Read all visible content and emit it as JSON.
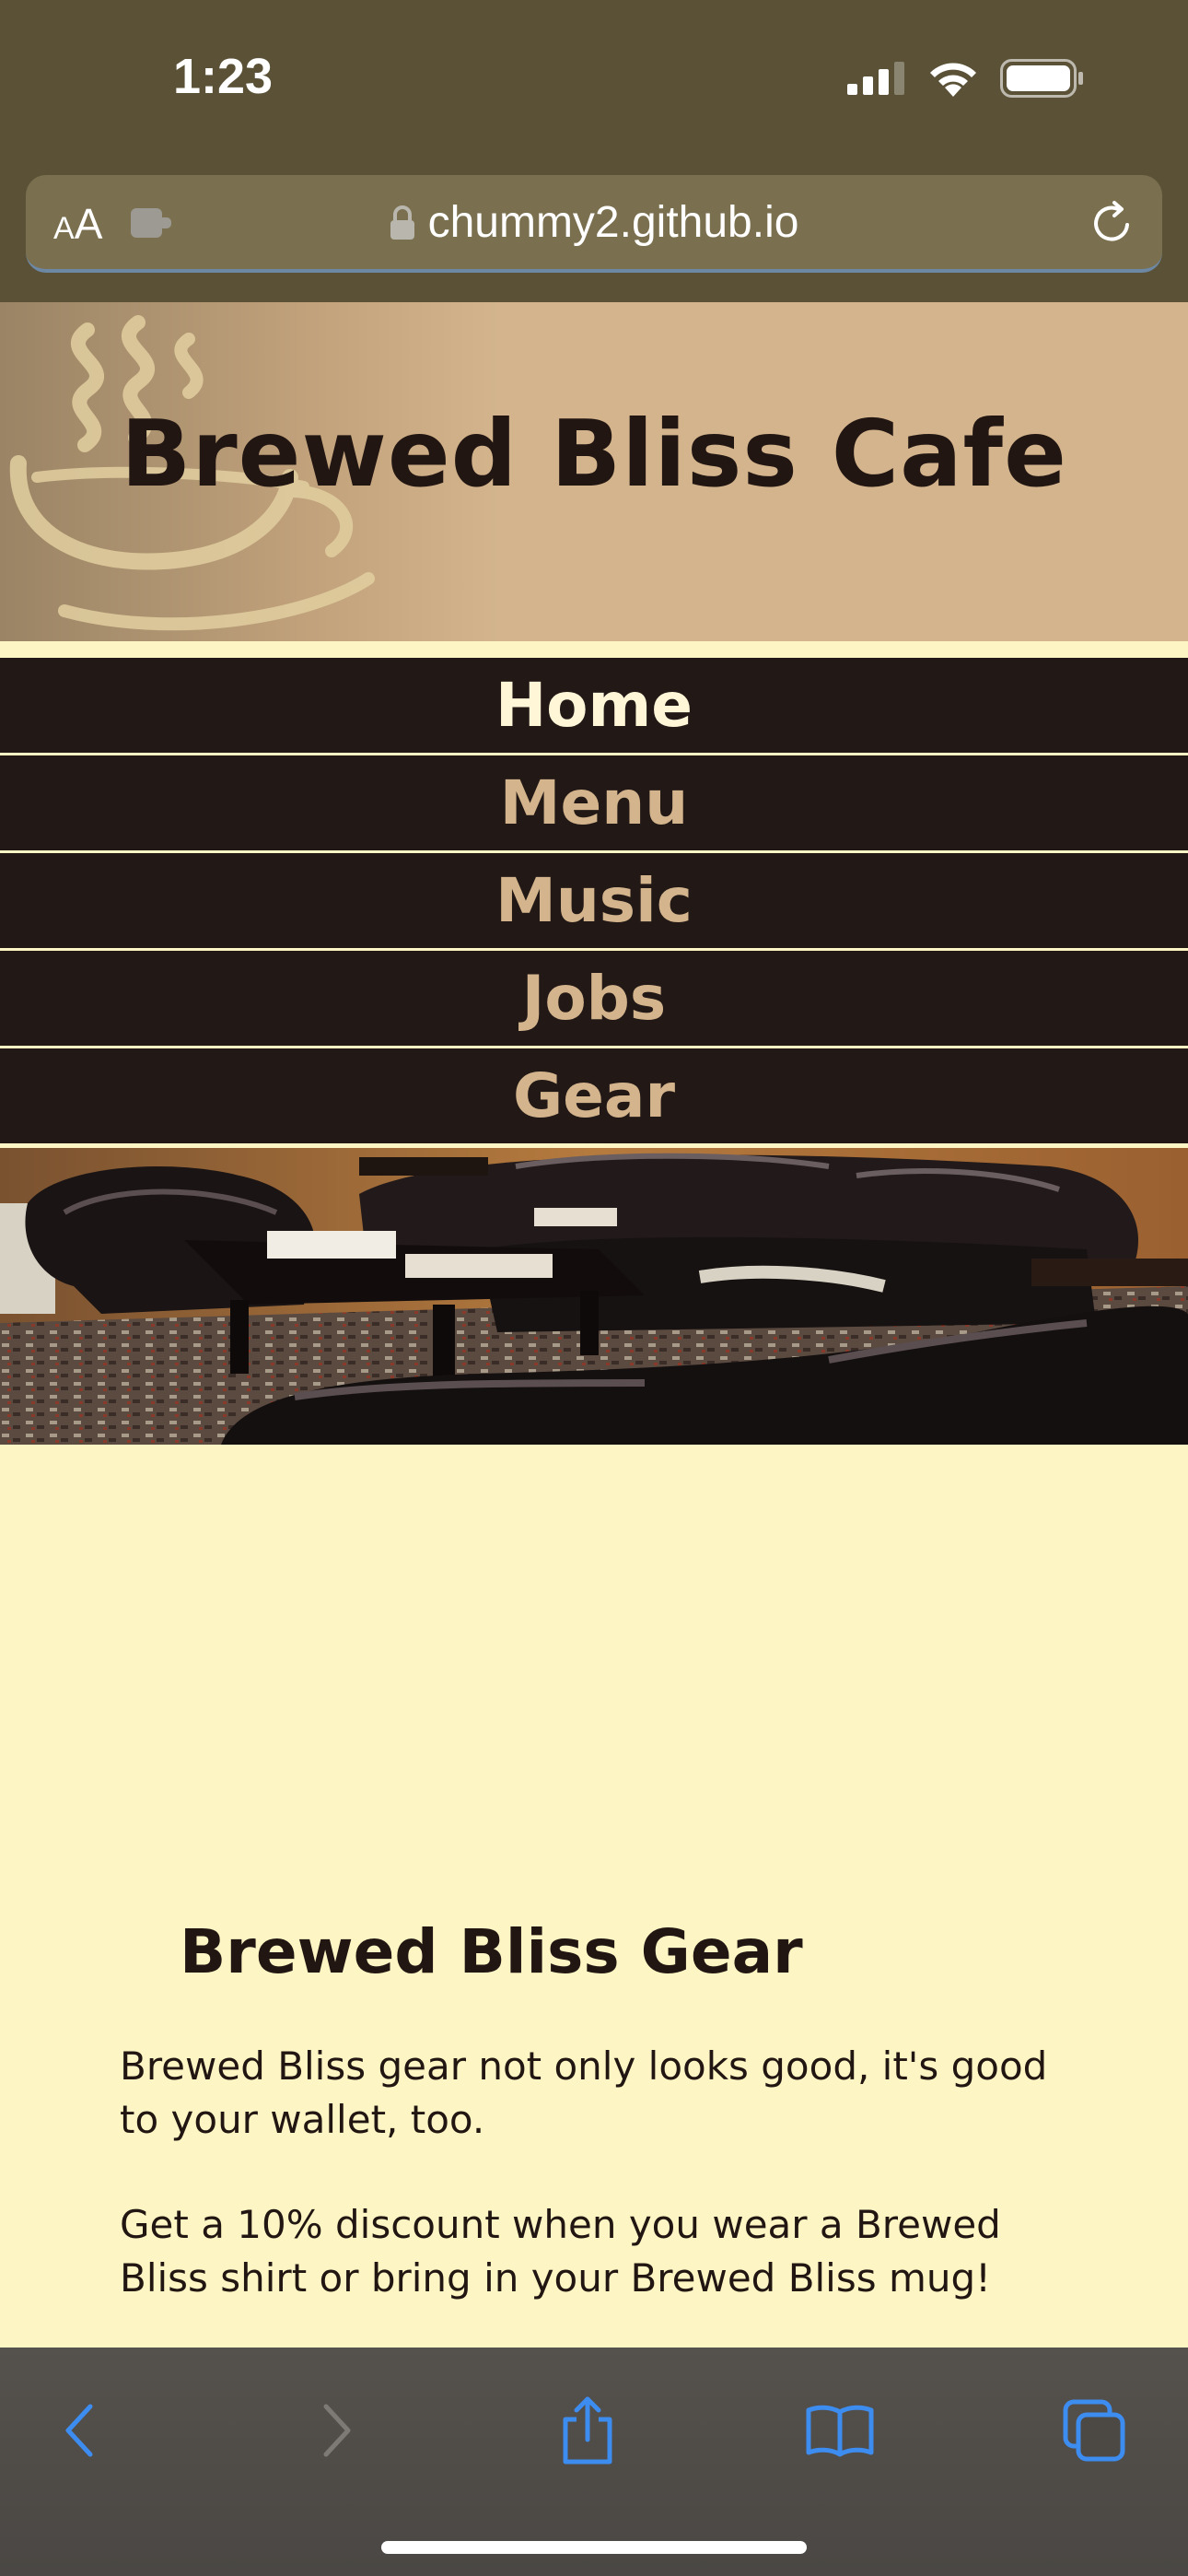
{
  "status_bar": {
    "time": "1:23"
  },
  "browser": {
    "text_size_label_small": "A",
    "text_size_label_large": "A",
    "url": "chummy2.github.io"
  },
  "site": {
    "title": "Brewed Bliss Cafe",
    "nav": [
      {
        "label": "Home",
        "active": true
      },
      {
        "label": "Menu",
        "active": false
      },
      {
        "label": "Music",
        "active": false
      },
      {
        "label": "Jobs",
        "active": false
      },
      {
        "label": "Gear",
        "active": false
      }
    ]
  },
  "content": {
    "heading": "Brewed Bliss Gear",
    "paragraph1": "Brewed Bliss gear not only looks good, it's good to your wallet, too.",
    "paragraph2": "Get a 10% discount when you wear a Brewed Bliss shirt or bring in your Brewed Bliss mug!"
  },
  "colors": {
    "chrome": "#5A5136",
    "header_tan": "#D3B48C",
    "nav_bg": "#221816",
    "nav_text": "#D3B48C",
    "nav_active_text": "#FFF6D8",
    "page_bg": "#FDF6C4",
    "text_dark": "#221613",
    "toolbar_icon": "#3D8CF0"
  }
}
